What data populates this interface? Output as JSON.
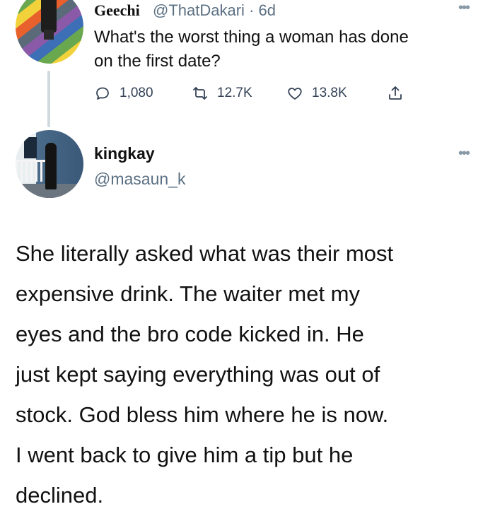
{
  "parent_tweet": {
    "display_name": "Geechi",
    "handle": "@ThatDakari",
    "separator": "·",
    "time": "6d",
    "more_icon": "more-dots-icon",
    "more_glyph": "•••",
    "text_lines": [
      "What's the worst thing a woman has done",
      "on the first date?"
    ],
    "actions": {
      "replies": "1,080",
      "retweets": "12.7K",
      "likes": "13.8K"
    }
  },
  "reply_tweet": {
    "display_name": "kingkay",
    "handle": "@masaun_k",
    "more_glyph": "•••",
    "body_lines": [
      "She literally asked what was their most",
      "expensive drink. The waiter met my",
      "eyes and the bro code kicked in. He",
      "just kept saying everything was out of",
      "stock. God bless him where he is now.",
      "I went back to give him a tip but he",
      "declined."
    ]
  },
  "colors": {
    "text": "#111111",
    "muted": "#5b7083",
    "thread_line": "#cfd9de"
  }
}
